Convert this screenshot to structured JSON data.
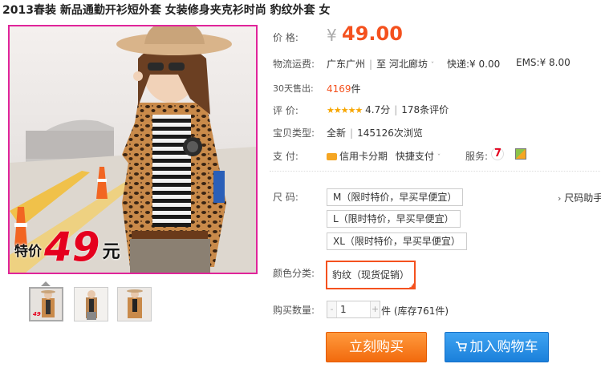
{
  "product": {
    "title": "2013春装 新品通勤开衫短外套 女装修身夹克衫时尚 豹纹外套 女"
  },
  "image": {
    "promo_label": "特价",
    "promo_number": "49",
    "promo_unit": "元",
    "thumb_promo": "49",
    "border_color": "#e0249a"
  },
  "price": {
    "label": "价 格:",
    "currency": "¥",
    "value": "49.00",
    "color": "#f4511e"
  },
  "shipping": {
    "label": "物流运费:",
    "from": "广东广州",
    "to_prefix": "至",
    "to": "河北廊坊",
    "express": "快递:¥ 0.00",
    "ems": "EMS:¥ 8.00"
  },
  "sales": {
    "label": "30天售出:",
    "count": "4169",
    "unit": "件"
  },
  "rating": {
    "label": "评 价:",
    "stars": "★★★★★",
    "score": "4.7分",
    "reviews": "178条评价"
  },
  "condition": {
    "label": "宝贝类型:",
    "type": "全新",
    "views": "145126次浏览"
  },
  "payment": {
    "label": "支 付:",
    "installment": "信用卡分期",
    "quick_pay": "快捷支付",
    "service_label": "服务:",
    "service_icon_text": "7"
  },
  "size": {
    "label": "尺 码:",
    "help": "尺码助手",
    "options": [
      "M（限时特价，早买早便宜）",
      "L（限时特价，早买早便宜）",
      "XL（限时特价，早买早便宜）"
    ]
  },
  "color": {
    "label": "颜色分类:",
    "selected": "豹纹（现货促销）",
    "check": "✓"
  },
  "quantity": {
    "label": "购买数量:",
    "dec": "-",
    "inc": "+",
    "value": "1",
    "stock": "件 (库存761件)"
  },
  "actions": {
    "buy_now": "立刻购买",
    "add_to_cart": "加入购物车",
    "buy_color": "#f77c19",
    "cart_color": "#2a8ee5"
  }
}
